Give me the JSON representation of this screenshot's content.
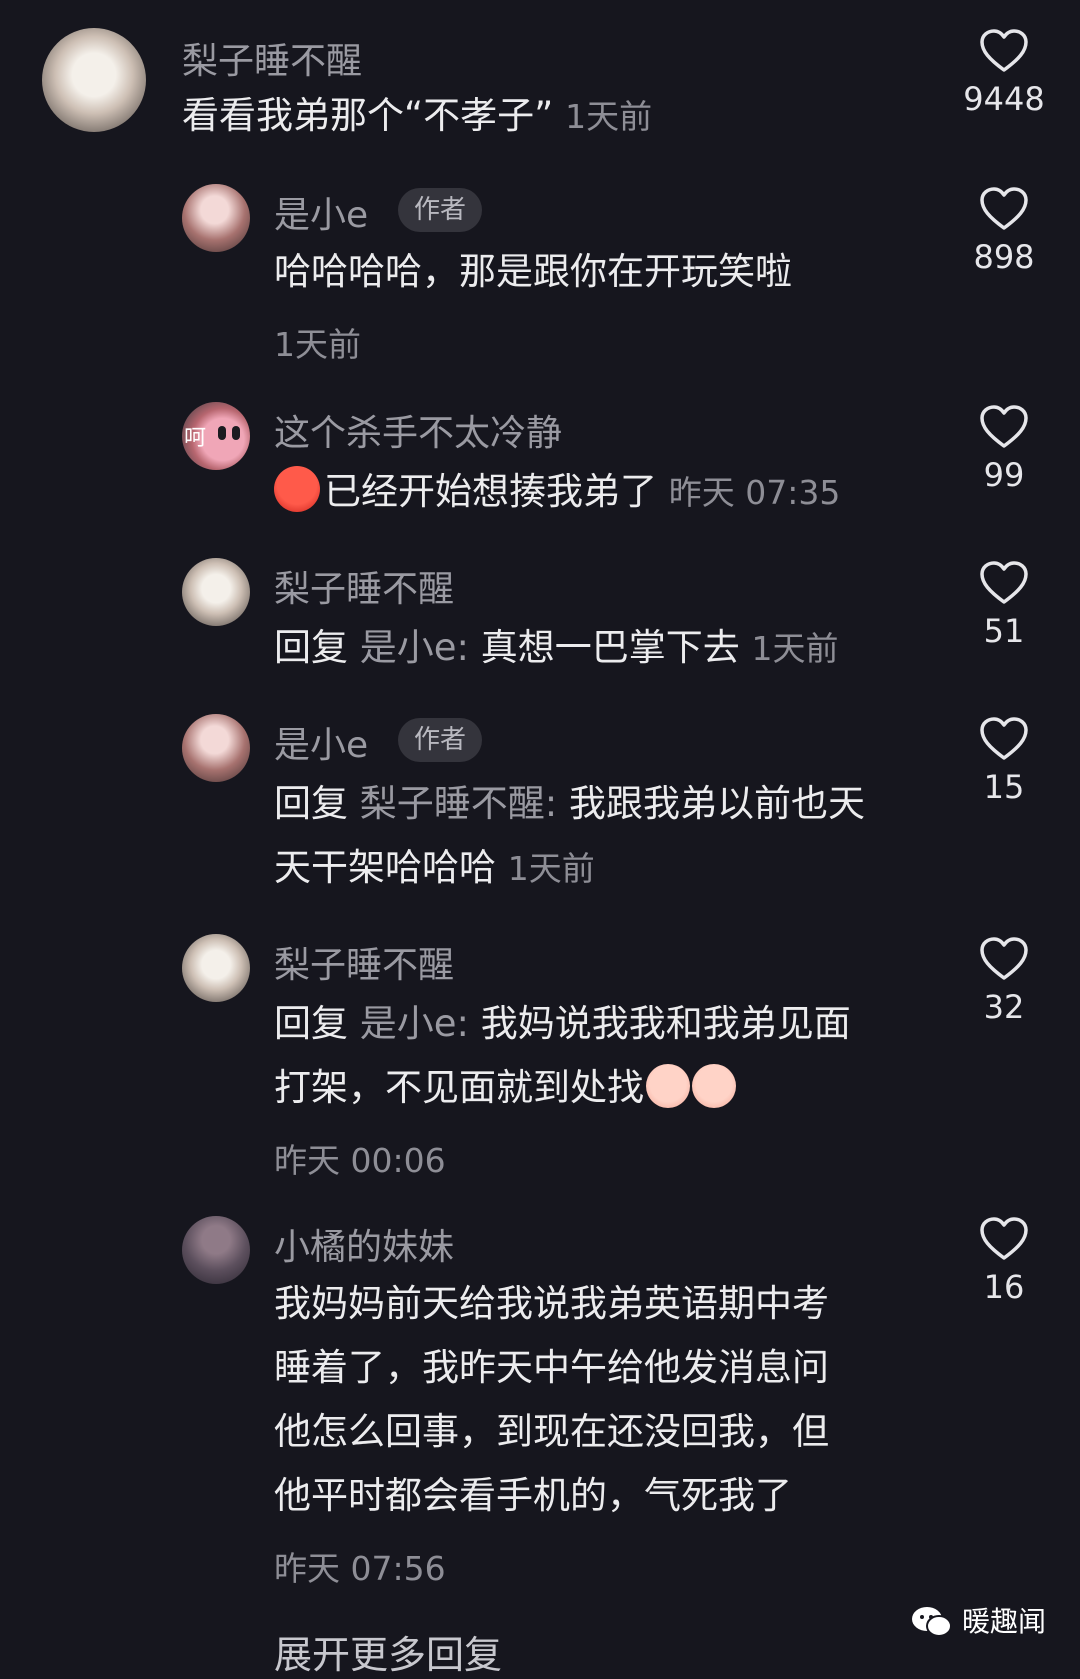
{
  "comments": [
    {
      "username": "梨子睡不醒",
      "text": "看看我弟那个“不孝子”",
      "time": "1天前",
      "likes": "9448"
    },
    {
      "username": "是小e",
      "badge": "作者",
      "text": "哈哈哈哈，那是跟你在开玩笑啦",
      "time": "1天前",
      "likes": "898"
    },
    {
      "username": "这个杀手不太冷静",
      "avatar_text": "呵",
      "emoji": "angry-face",
      "text": "已经开始想揍我弟了",
      "time": "昨天 07:35",
      "likes": "99"
    },
    {
      "username": "梨子睡不醒",
      "reply_prefix": "回复",
      "reply_to": "是小e:",
      "text": "真想一巴掌下去",
      "time": "1天前",
      "likes": "51"
    },
    {
      "username": "是小e",
      "badge": "作者",
      "reply_prefix": "回复",
      "reply_to": "梨子睡不醒:",
      "text_line1": "我跟我弟以前也天",
      "text_line2": "天干架哈哈哈",
      "time": "1天前",
      "likes": "15"
    },
    {
      "username": "梨子睡不醒",
      "reply_prefix": "回复",
      "reply_to": "是小e:",
      "text_line1": "我妈说我我和我弟见面",
      "text_line2": "打架，不见面就到处找",
      "emoji": "crying-face",
      "time": "昨天 00:06",
      "likes": "32"
    },
    {
      "username": "小橘的妹妹",
      "text_line1": "我妈妈前天给我说我弟英语期中考",
      "text_line2": "睡着了，我昨天中午给他发消息问",
      "text_line3": "他怎么回事，到现在还没回我，但",
      "text_line4": "他平时都会看手机的，气死我了",
      "time": "昨天 07:56",
      "likes": "16"
    }
  ],
  "expand_more": "展开更多回复",
  "watermark": "暖趣闻",
  "colors": {
    "background": "#16161e",
    "text": "#ececee",
    "muted": "#9a9aa2"
  }
}
